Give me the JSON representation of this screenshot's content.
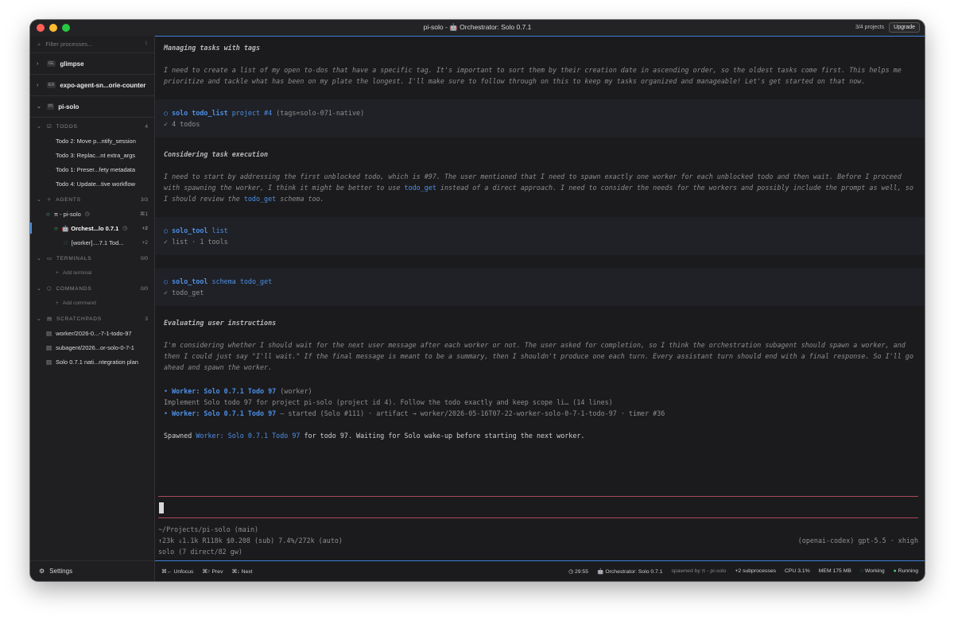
{
  "window": {
    "title": "pi-solo - 🤖 Orchestrator: Solo 0.7.1",
    "projects_count": "3/4 projects",
    "upgrade_label": "Upgrade"
  },
  "sidebar": {
    "filter_placeholder": "Filter processes...",
    "filter_shortcut": "\\",
    "projects": [
      {
        "badge": "GL",
        "name": "glimpse"
      },
      {
        "badge": "EX",
        "name": "expo-agent-sn...orie-counter"
      },
      {
        "badge": "PI",
        "name": "pi-solo"
      }
    ],
    "todos": {
      "label": "TODOS",
      "count": "4",
      "items": [
        "Todo 2: Move p...ntify_session",
        "Todo 3: Replac...nt extra_args",
        "Todo 1: Preser...fety metadata",
        "Todo 4: Update...tive workflow"
      ]
    },
    "agents": {
      "label": "AGENTS",
      "count": "3/3",
      "items": [
        {
          "name": "π - pi-solo",
          "right": "⌘1"
        },
        {
          "name": "🤖 Orchest...lo 0.7.1",
          "right": "+2"
        },
        {
          "name": "[worker]....7.1 Tod...",
          "right": "+2"
        }
      ]
    },
    "terminals": {
      "label": "TERMINALS",
      "count": "0/0",
      "add": "Add terminal"
    },
    "commands": {
      "label": "COMMANDS",
      "count": "0/0",
      "add": "Add command"
    },
    "scratchpads": {
      "label": "SCRATCHPADS",
      "count": "3",
      "items": [
        "worker/2026-0...-7-1-todo-97",
        "subagent/2026...or-solo-0-7-1",
        "Solo 0.7.1 nati...ntegration plan"
      ]
    },
    "settings_label": "Settings"
  },
  "conversation": {
    "h1": "Managing tasks with tags",
    "t1": "I need to create a list of my open to-dos that have a specific tag. It's important to sort them by their creation date in ascending order, so the oldest tasks come first. This helps me prioritize and tackle what has been on my plate the longest. I'll make sure to follow through on this to keep my tasks organized and manageable! Let's get started on that now.",
    "tool1": {
      "cmd": "solo todo_list",
      "args": "project #4",
      "extra": "(tags=solo-071-native)",
      "result": "✓ 4 todos"
    },
    "h2": "Considering task execution",
    "t2a": "I need to start by addressing the first unblocked todo, which is #97. The user mentioned that I need to spawn exactly one worker for each unblocked todo and then wait. Before I proceed with spawning the worker, I think it might be better to use ",
    "t2_link1": "todo_get",
    "t2b": " instead of a direct approach. I need to consider the needs for the workers and possibly include the prompt as well, so I should review the ",
    "t2_link2": "todo_get",
    "t2c": " schema too.",
    "tool2": {
      "cmd": "solo_tool",
      "args": "list",
      "result": "✓ list · 1 tools"
    },
    "tool3": {
      "cmd": "solo_tool",
      "args": "schema todo_get",
      "result": "✓ todo_get"
    },
    "h3": "Evaluating user instructions",
    "t3": "I'm considering whether I should wait for the next user message after each worker or not. The user asked for completion, so I think the orchestration subagent should spawn a worker, and then I could just say \"I'll wait.\" If the final message is meant to be a summary, then I shouldn't produce one each turn. Every assistant turn should end with a final response. So I'll go ahead and spawn the worker.",
    "spawn": {
      "l1_name": "Worker: Solo 0.7.1 Todo 97",
      "l1_rest": " (worker)",
      "l2": "Implement Solo todo 97 for project pi-solo (project id 4). Follow the todo exactly and keep scope li… (14 lines)",
      "l3_name": "Worker: Solo 0.7.1 Todo 97",
      "l3_rest": " — started (Solo #111) · artifact → worker/2026-05-16T07-22-worker-solo-0-7-1-todo-97 · timer #36"
    },
    "final_a": "Spawned ",
    "final_link": "Worker: Solo 0.7.1 Todo 97",
    "final_b": " for todo 97. Waiting for Solo wake-up before starting the next worker."
  },
  "status": {
    "path": "~/Projects/pi-solo (main)",
    "usage": "↑23k ↓1.1k R118k $0.208 (sub) 7.4%/272k (auto)",
    "model": "(openai-codex) gpt-5.5 · xhigh",
    "solo": "solo (7 direct/82 gw)"
  },
  "footer": {
    "unfocus": "⌘← Unfocus",
    "prev": "⌘↑ Prev",
    "next": "⌘↓ Next",
    "timer": "29:55",
    "agent": "🤖 Orchestrator: Solo 0.7.1",
    "spawned_by": "spawned by π - pi-solo",
    "subprocesses": "+2 subprocesses",
    "cpu": "CPU 3.1%",
    "mem": "MEM 175 MB",
    "working": "Working",
    "running": "Running"
  }
}
